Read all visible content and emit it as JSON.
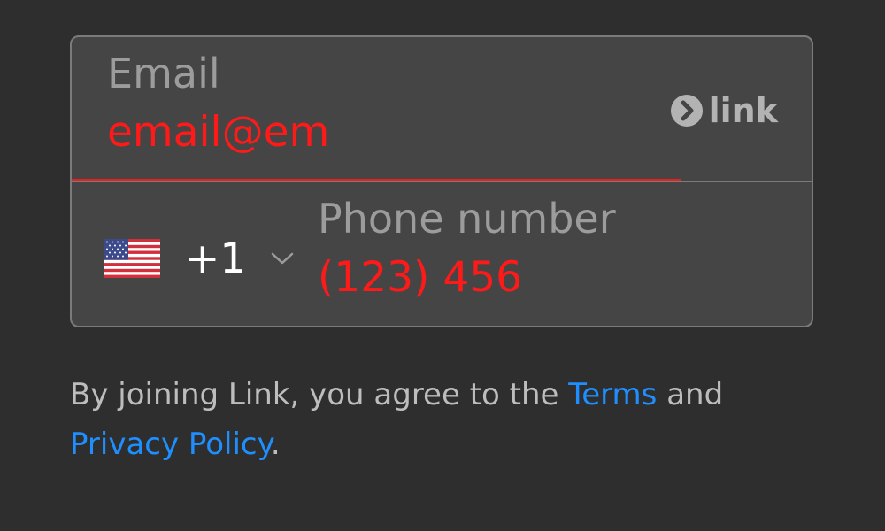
{
  "form": {
    "email": {
      "label": "Email",
      "value": "email@em",
      "state": "error"
    },
    "link_badge": {
      "icon": "chevron-right-circle-icon",
      "text": "link"
    },
    "phone": {
      "country_flag": "us-flag-icon",
      "dial_code": "+1",
      "label": "Phone number",
      "value": "(123) 456",
      "state": "error"
    }
  },
  "terms": {
    "text_before": "By joining Link, you agree to the",
    "terms_link": "Terms",
    "text_middle": "and",
    "privacy_link": "Privacy Policy",
    "text_after": "."
  },
  "colors": {
    "background": "#2e2e2e",
    "card": "#454545",
    "border": "#7b7b7b",
    "error": "#ff1a1a",
    "link": "#1f8fff"
  }
}
